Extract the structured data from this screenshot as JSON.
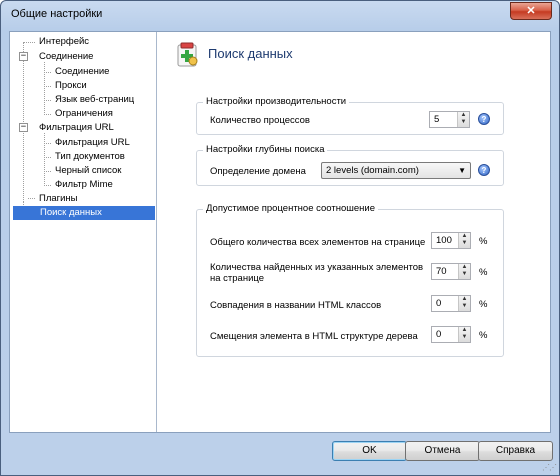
{
  "window": {
    "title": "Общие настройки",
    "close_glyph": "✕"
  },
  "tree": {
    "items": [
      {
        "label": "Интерфейс"
      },
      {
        "label": "Соединение",
        "expander": "−"
      },
      {
        "label": "Соединение"
      },
      {
        "label": "Прокси"
      },
      {
        "label": "Язык веб-страниц"
      },
      {
        "label": "Ограничения"
      },
      {
        "label": "Фильтрация URL",
        "expander": "−"
      },
      {
        "label": "Фильтрация URL"
      },
      {
        "label": "Тип документов"
      },
      {
        "label": "Черный список"
      },
      {
        "label": "Фильтр Mime"
      },
      {
        "label": "Плагины"
      },
      {
        "label": "Поиск данных",
        "selected": true
      }
    ]
  },
  "page": {
    "title": "Поиск данных",
    "icon": "data-search-page-icon"
  },
  "performance": {
    "title": "Настройки производительности",
    "processes_label": "Количество процессов",
    "processes_value": "5"
  },
  "depth": {
    "title": "Настройки глубины поиска",
    "domain_label": "Определение домена",
    "domain_value": "2 levels (domain.com)"
  },
  "percentages": {
    "title": "Допустимое процентное соотношение",
    "rows": [
      {
        "label": "Общего количества всех элементов на странице",
        "value": "100",
        "unit": "%"
      },
      {
        "label": "Количества найденных из указанных элементов на странице",
        "value": "70",
        "unit": "%"
      },
      {
        "label": "Совпадения в названии HTML классов",
        "value": "0",
        "unit": "%"
      },
      {
        "label": "Смещения элемента в HTML структуре дерева",
        "value": "0",
        "unit": "%"
      }
    ]
  },
  "help_glyph": "?",
  "spin_up": "▲",
  "spin_down": "▼",
  "combo_arrow": "▼",
  "buttons": {
    "ok": "OK",
    "cancel": "Отмена",
    "help": "Справка"
  },
  "colors": {
    "selection": "#3875d7",
    "page_title": "#1e3b70"
  }
}
